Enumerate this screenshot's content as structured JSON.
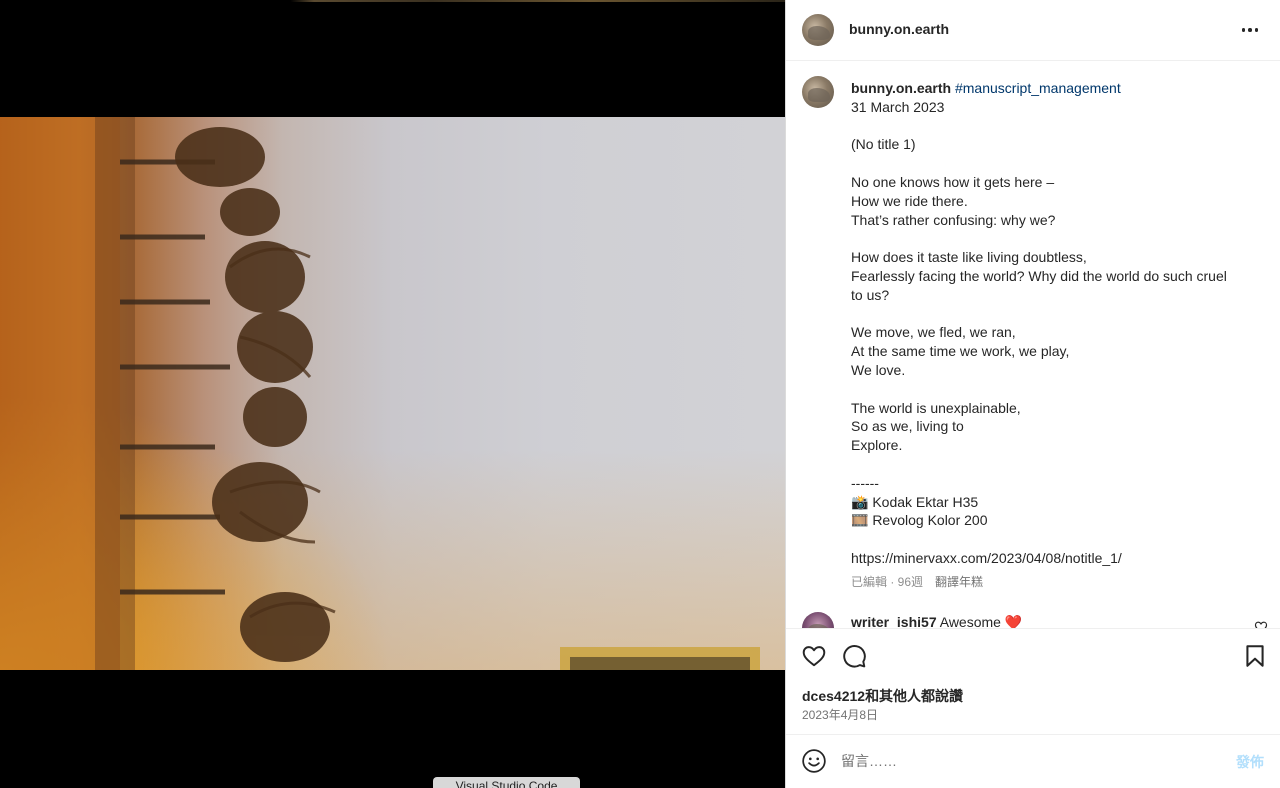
{
  "post": {
    "author": "bunny.on.earth",
    "caption": {
      "author": "bunny.on.earth",
      "hashtag": "#manuscript_management",
      "lines": [
        "31 March 2023",
        "",
        "(No title 1)",
        "",
        "No one knows how it gets here –",
        "How we ride there.",
        "That’s rather confusing: why we?",
        "",
        "How does it taste like living doubtless,",
        "Fearlessly facing the world? Why did the world do such cruel",
        "to us?",
        "",
        "We move, we fled, we ran,",
        "At the same time we work, we play,",
        "We love.",
        "",
        "The world is unexplainable,",
        "So as we, living to",
        "Explore.",
        "",
        "------",
        "📸 Kodak Ektar H35",
        "🎞️ Revolog Kolor 200",
        "",
        "https://minervaxx.com/2023/04/08/notitle_1/"
      ],
      "meta": "已編輯 · 96週",
      "translate": "翻譯年糕"
    },
    "comment": {
      "author": "writer_ishi57",
      "text": "Awesome ❤️"
    },
    "likes": {
      "user": "dces4212",
      "rest": "和其他人都說讚"
    },
    "date": "2023年4月8日",
    "composer": {
      "placeholder": "留言……",
      "post_label": "發佈"
    }
  },
  "dock": {
    "label": "Visual Studio Code"
  },
  "icons": {
    "more": "more-icon",
    "like": "heart-icon",
    "comment": "comment-icon",
    "save": "bookmark-icon",
    "emoji": "emoji-icon"
  },
  "colors": {
    "hashtag": "#00376b",
    "post_button": "#b2dffc",
    "muted": "#737373"
  }
}
